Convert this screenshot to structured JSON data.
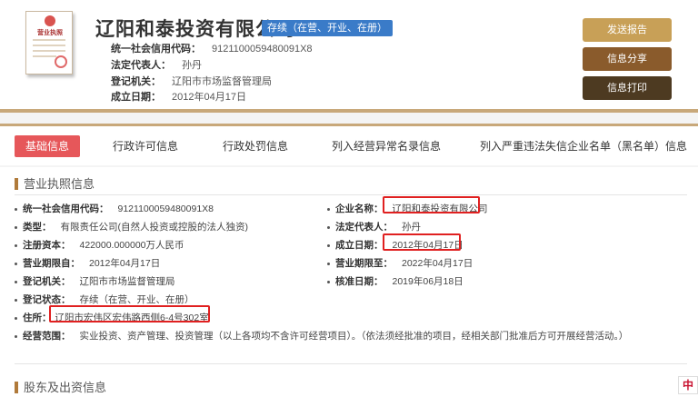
{
  "header": {
    "license_title": "营业执照",
    "company_name": "辽阳和泰投资有限公司",
    "status": "存续（在营、开业、在册）",
    "rows": [
      {
        "label": "统一社会信用代码：",
        "value": "9121100059480091X8"
      },
      {
        "label": "法定代表人：",
        "value": "孙丹"
      },
      {
        "label": "登记机关：",
        "value": "辽阳市市场监督管理局"
      },
      {
        "label": "成立日期：",
        "value": "2012年04月17日"
      }
    ],
    "buttons": {
      "send": "发送报告",
      "share": "信息分享",
      "print": "信息打印"
    }
  },
  "tabs": [
    {
      "label": "基础信息",
      "active": true
    },
    {
      "label": "行政许可信息"
    },
    {
      "label": "行政处罚信息"
    },
    {
      "label": "列入经营异常名录信息"
    },
    {
      "label": "列入严重违法失信企业名单（黑名单）信息"
    }
  ],
  "section1": {
    "title": "营业执照信息",
    "fields": {
      "credit_code": {
        "label": "统一社会信用代码：",
        "value": "9121100059480091X8"
      },
      "company_name": {
        "label": "企业名称：",
        "value": "辽阳和泰投资有限公司"
      },
      "type": {
        "label": "类型：",
        "value": "有限责任公司(自然人投资或控股的法人独资)"
      },
      "legal_rep": {
        "label": "法定代表人：",
        "value": "孙丹"
      },
      "capital": {
        "label": "注册资本：",
        "value": "422000.000000万人民币"
      },
      "established": {
        "label": "成立日期：",
        "value": "2012年04月17日"
      },
      "term_from": {
        "label": "营业期限自：",
        "value": "2012年04月17日"
      },
      "term_to": {
        "label": "营业期限至：",
        "value": "2022年04月17日"
      },
      "authority": {
        "label": "登记机关：",
        "value": "辽阳市市场监督管理局"
      },
      "approval_date": {
        "label": "核准日期：",
        "value": "2019年06月18日"
      },
      "status": {
        "label": "登记状态：",
        "value": "存续（在营、开业、在册）"
      },
      "address": {
        "label": "住所：",
        "value": "辽阳市宏伟区宏伟路西侧6-4号302室"
      },
      "scope": {
        "label": "经营范围：",
        "value": "实业投资、资产管理、投资管理（以上各项均不含许可经营项目）。（依法须经批准的项目，经相关部门批准后方可开展经营活动。）"
      }
    }
  },
  "section2": {
    "title": "股东及出资信息"
  },
  "float_lang": "中",
  "colors": {
    "accent": "#c8a87a",
    "tab_active": "#e6575a",
    "badge": "#3a7bc8",
    "highlight": "#e02020"
  }
}
